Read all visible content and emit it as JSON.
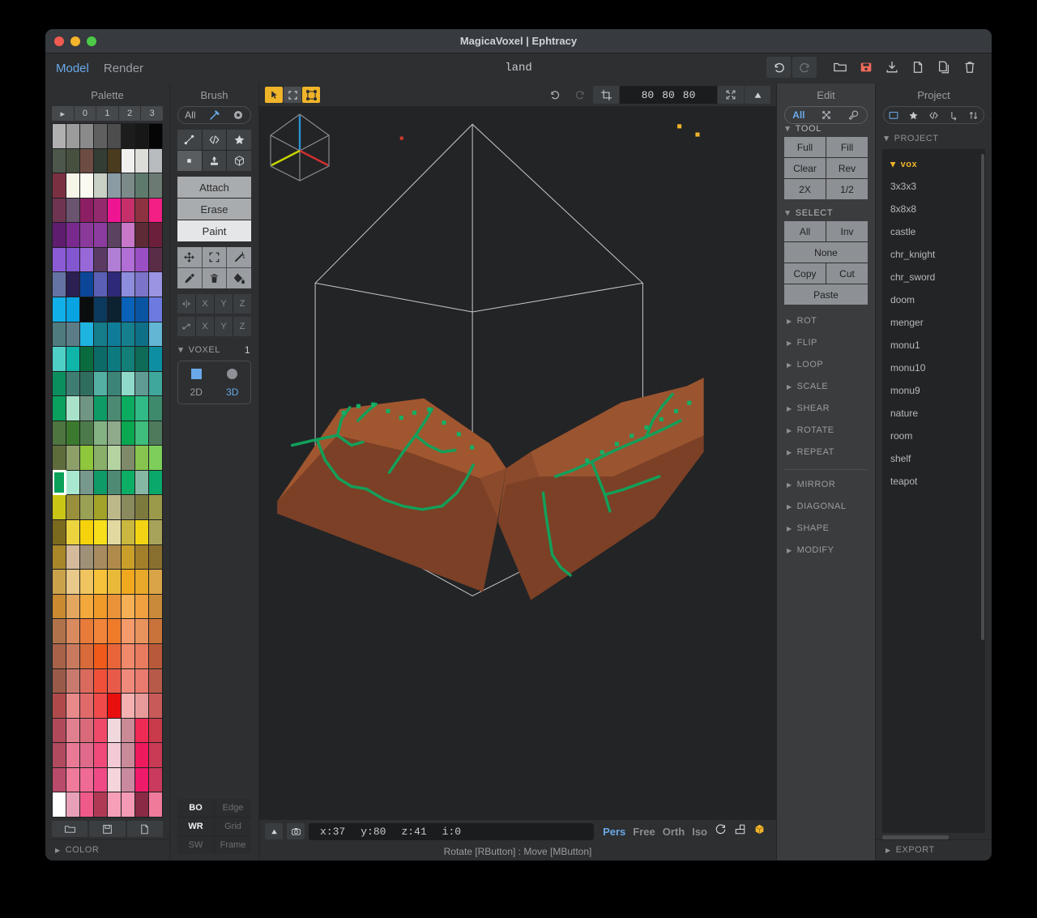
{
  "window": {
    "title": "MagicaVoxel | Ephtracy",
    "document_name": "land"
  },
  "menu": {
    "items": [
      {
        "label": "Model",
        "active": true
      },
      {
        "label": "Render",
        "active": false
      }
    ]
  },
  "top_toolbar": {
    "buttons": [
      {
        "name": "undo-button",
        "icon": "undo-icon",
        "enabled": true
      },
      {
        "name": "redo-button",
        "icon": "redo-icon",
        "enabled": false
      },
      {
        "name": "open-button",
        "icon": "folder-open-icon",
        "enabled": true
      },
      {
        "name": "save-button",
        "icon": "floppy-disk-icon",
        "enabled": true,
        "color": "#f26b5b"
      },
      {
        "name": "download-button",
        "icon": "download-icon",
        "enabled": true
      },
      {
        "name": "new-file-button",
        "icon": "file-icon",
        "enabled": true
      },
      {
        "name": "duplicate-button",
        "icon": "copy-icon",
        "enabled": true
      },
      {
        "name": "delete-button",
        "icon": "trash-icon",
        "enabled": true
      }
    ]
  },
  "palette": {
    "header": "Palette",
    "tabs": [
      "▸",
      "0",
      "1",
      "2",
      "3"
    ],
    "selected_index": 112,
    "footer_buttons": [
      "folder-open-icon",
      "floppy-disk-icon",
      "file-icon"
    ],
    "color_section": "COLOR",
    "colors": [
      "#b0b0b0",
      "#9b9b9b",
      "#8a8a8a",
      "#5f5f5f",
      "#4d4d4d",
      "#1d1d1d",
      "#171717",
      "#050505",
      "#4d574b",
      "#47503f",
      "#6d4c43",
      "#333d33",
      "#4a3a1e",
      "#f0f0ee",
      "#dcdcd8",
      "#b9bcbe",
      "#7b3042",
      "#f7f5e8",
      "#fbfaf1",
      "#c9d0c4",
      "#8b9ba4",
      "#7d8a8a",
      "#5e7a6c",
      "#6b7a72",
      "#6e3450",
      "#6b5470",
      "#8c1f63",
      "#942a6e",
      "#ef1491",
      "#c62f6a",
      "#8e3241",
      "#f41f85",
      "#5e1d6e",
      "#7a2a8f",
      "#8b3a9c",
      "#8c3b9e",
      "#5b4260",
      "#c778c9",
      "#5e2a35",
      "#6b1f3a",
      "#8b5bd6",
      "#8257d0",
      "#9868d9",
      "#5a3a63",
      "#b07fd5",
      "#b06ed6",
      "#9a4fc4",
      "#5a2d47",
      "#6573a4",
      "#2c1f52",
      "#0b4699",
      "#5b5fb5",
      "#2e2a79",
      "#8e8ddd",
      "#7b74c9",
      "#9a94e3",
      "#12b0e8",
      "#08a4e2",
      "#090d0d",
      "#0b3a5e",
      "#0d2231",
      "#0a61b8",
      "#0a55a3",
      "#6d7ae0",
      "#4f7b7f",
      "#5c7d88",
      "#1fb3e0",
      "#157c8a",
      "#0f7d9a",
      "#157f8e",
      "#0f6f87",
      "#63b6d4",
      "#4fd0c6",
      "#10b5aa",
      "#0a6b3f",
      "#0c6b66",
      "#0d7a80",
      "#127f78",
      "#0d6b56",
      "#0e8fa1",
      "#0c8f5e",
      "#3f7d72",
      "#2f6d5e",
      "#54b0a3",
      "#3c8478",
      "#8fd9c9",
      "#5f9a93",
      "#3fa79b",
      "#0aa05e",
      "#a8e3c9",
      "#6f9583",
      "#0f9b66",
      "#4c8a73",
      "#0bab60",
      "#2fba86",
      "#3e8a6c",
      "#4e7540",
      "#3b7a2e",
      "#4c7a4a",
      "#84b283",
      "#8fa98b",
      "#0aa851",
      "#3ebd7c",
      "#4f7a5c",
      "#5e6c3c",
      "#8da06a",
      "#8ec73c",
      "#88b06a",
      "#b4d3a0",
      "#7f8a6a",
      "#86c44f",
      "#7ccf5b",
      "#0ba05a",
      "#a9e8d0",
      "#77988d",
      "#0f9b67",
      "#4e8a74",
      "#0cae64",
      "#86b7a5",
      "#0aa86a",
      "#c9c616",
      "#9a8f3a",
      "#9aa054",
      "#a3a32a",
      "#bcb88a",
      "#8a8a5e",
      "#7d7a3e",
      "#9a9a4a",
      "#7a6a1e",
      "#ecd43f",
      "#f5d20b",
      "#f7df1b",
      "#e2d9a0",
      "#c9b73f",
      "#f2d414",
      "#a8a35a",
      "#a8862a",
      "#d4b99a",
      "#9f9078",
      "#a88b5e",
      "#b08a4a",
      "#c99f2a",
      "#a37f2a",
      "#8a7030",
      "#c9a24a",
      "#e8c98a",
      "#f0c45e",
      "#f5c23a",
      "#e9b93a",
      "#f0a81f",
      "#e8a82a",
      "#d8a447",
      "#c98a30",
      "#e3a65e",
      "#f2a83a",
      "#f09a2a",
      "#e8933a",
      "#f5b055",
      "#f0a040",
      "#c98b3a",
      "#b0724a",
      "#d98a5e",
      "#e87a3a",
      "#f2843a",
      "#ef7a2a",
      "#f59a6a",
      "#e8935e",
      "#c9733a",
      "#a8624a",
      "#c97a5e",
      "#d96a3a",
      "#f05a1a",
      "#e8653a",
      "#f08a6a",
      "#e87a5e",
      "#b85a3a",
      "#9a5a4a",
      "#c97a6e",
      "#d96a5e",
      "#f0503a",
      "#e85a4a",
      "#f08a7a",
      "#e87a6e",
      "#b85a4a",
      "#b04a4a",
      "#e88a8a",
      "#e06a6a",
      "#f04a4a",
      "#ea0f0f",
      "#f5b0b0",
      "#e89a9a",
      "#c95a5a",
      "#b04a5a",
      "#e0808f",
      "#d96a7a",
      "#ef4a6a",
      "#f0d8dc",
      "#c98a95",
      "#ef2a55",
      "#c93a4a",
      "#b04a5e",
      "#e87a95",
      "#e06a8a",
      "#ef4a7a",
      "#f2c9d4",
      "#c98a9a",
      "#ef1a5e",
      "#c93a55",
      "#b84a6a",
      "#ef7a9a",
      "#ef6a95",
      "#ef4a85",
      "#f5d4dc",
      "#c98aa0",
      "#f01a6a",
      "#c93a5e",
      "#fefefe",
      "#e8a0b8",
      "#ef5a8a",
      "#b03a55",
      "#f5a0b8",
      "#f59ab4",
      "#8a2a44",
      "#ef7a9a"
    ]
  },
  "brush": {
    "header": "Brush",
    "tabs": [
      {
        "label": "All",
        "name": "brush-tab-all"
      },
      {
        "label": "",
        "name": "brush-icon"
      },
      {
        "label": "",
        "name": "gear-icon"
      }
    ],
    "shape_icons": [
      {
        "name": "line-icon",
        "active": false
      },
      {
        "name": "code-icon",
        "active": false
      },
      {
        "name": "star-icon",
        "active": false
      },
      {
        "name": "voxel-square-icon",
        "active": true
      },
      {
        "name": "pattern-stamp-icon",
        "active": false
      },
      {
        "name": "box-icon",
        "active": false
      }
    ],
    "modes": [
      {
        "label": "Attach",
        "active": false
      },
      {
        "label": "Erase",
        "active": false
      },
      {
        "label": "Paint",
        "active": true
      }
    ],
    "tool_icons": [
      {
        "name": "move-icon"
      },
      {
        "name": "select-region-icon"
      },
      {
        "name": "magic-wand-icon"
      },
      {
        "name": "eyedropper-icon"
      },
      {
        "name": "trash-icon"
      },
      {
        "name": "bucket-fill-icon"
      }
    ],
    "mirror_row": {
      "icon": "mirror-icon",
      "axes": [
        "X",
        "Y",
        "Z"
      ]
    },
    "scale_row": {
      "icon": "diagonal-arrow-icon",
      "axes": [
        "X",
        "Y",
        "Z"
      ]
    },
    "voxel": {
      "label": "VOXEL",
      "value": "1"
    },
    "dimension": [
      {
        "label": "2D",
        "active": false,
        "shape": "square"
      },
      {
        "label": "3D",
        "active": true,
        "shape": "circle"
      }
    ],
    "display_toggles": [
      {
        "label": "BO",
        "active": true
      },
      {
        "label": "Edge",
        "active": false
      },
      {
        "label": "WR",
        "active": true
      },
      {
        "label": "Grid",
        "active": false
      },
      {
        "label": "SW",
        "active": false
      },
      {
        "label": "Frame",
        "active": false
      }
    ]
  },
  "viewport": {
    "tools": [
      {
        "name": "cursor-tool",
        "active": true
      },
      {
        "name": "marquee-select-tool",
        "active": false
      },
      {
        "name": "box-select-tool",
        "active": true
      }
    ],
    "undo": "undo-icon",
    "redo": "redo-icon",
    "crop": "crop-icon",
    "size": [
      "80",
      "80",
      "80"
    ],
    "fit_icon": "fit-screen-icon",
    "up_icon": "triangle-up-icon"
  },
  "statusbar": {
    "left_icons": [
      "triangle-up-icon",
      "camera-icon"
    ],
    "coords": [
      "x:37",
      "y:80",
      "z:41",
      "i:0"
    ],
    "view_modes": [
      {
        "label": "Pers",
        "active": true
      },
      {
        "label": "Free",
        "active": false
      },
      {
        "label": "Orth",
        "active": false
      },
      {
        "label": "Iso",
        "active": false
      }
    ],
    "right_icons": [
      "rotate-icon",
      "grid-icon",
      "box-orange-icon"
    ],
    "hint": "Rotate [RButton] : Move [MButton]"
  },
  "edit": {
    "header": "Edit",
    "tabs": [
      {
        "label": "All",
        "active": true,
        "name": "edit-tab-all"
      },
      {
        "label": "",
        "active": false,
        "name": "transform-icon"
      },
      {
        "label": "",
        "active": false,
        "name": "wrench-icon"
      }
    ],
    "tool_section": "TOOL",
    "tool_buttons": [
      "Full",
      "Fill",
      "Clear",
      "Rev",
      "2X",
      "1/2"
    ],
    "select_section": "SELECT",
    "select_buttons": [
      "All",
      "Inv",
      "None",
      "Copy",
      "Cut",
      "Paste"
    ],
    "collapsed_sections": [
      "ROT",
      "FLIP",
      "LOOP",
      "SCALE",
      "SHEAR",
      "ROTATE",
      "REPEAT"
    ],
    "collapsed_sections_2": [
      "MIRROR",
      "DIAGONAL",
      "SHAPE",
      "MODIFY"
    ]
  },
  "project": {
    "header": "Project",
    "tabs": [
      {
        "name": "folder-icon",
        "active": true
      },
      {
        "name": "star-icon",
        "active": false
      },
      {
        "name": "code-icon",
        "active": false
      },
      {
        "name": "branch-icon",
        "active": false
      },
      {
        "name": "sort-icon",
        "active": false
      }
    ],
    "section": "PROJECT",
    "root": "vox",
    "items": [
      "3x3x3",
      "8x8x8",
      "castle",
      "chr_knight",
      "chr_sword",
      "doom",
      "menger",
      "monu1",
      "monu10",
      "monu9",
      "nature",
      "room",
      "shelf",
      "teapot"
    ],
    "export_section": "EXPORT"
  },
  "colors": {
    "accent_blue": "#6aa9e8",
    "accent_gold": "#f0b429",
    "save_red": "#f26b5b",
    "terrain_brown": "#8a4a2b",
    "terrain_green": "#12a05a"
  }
}
